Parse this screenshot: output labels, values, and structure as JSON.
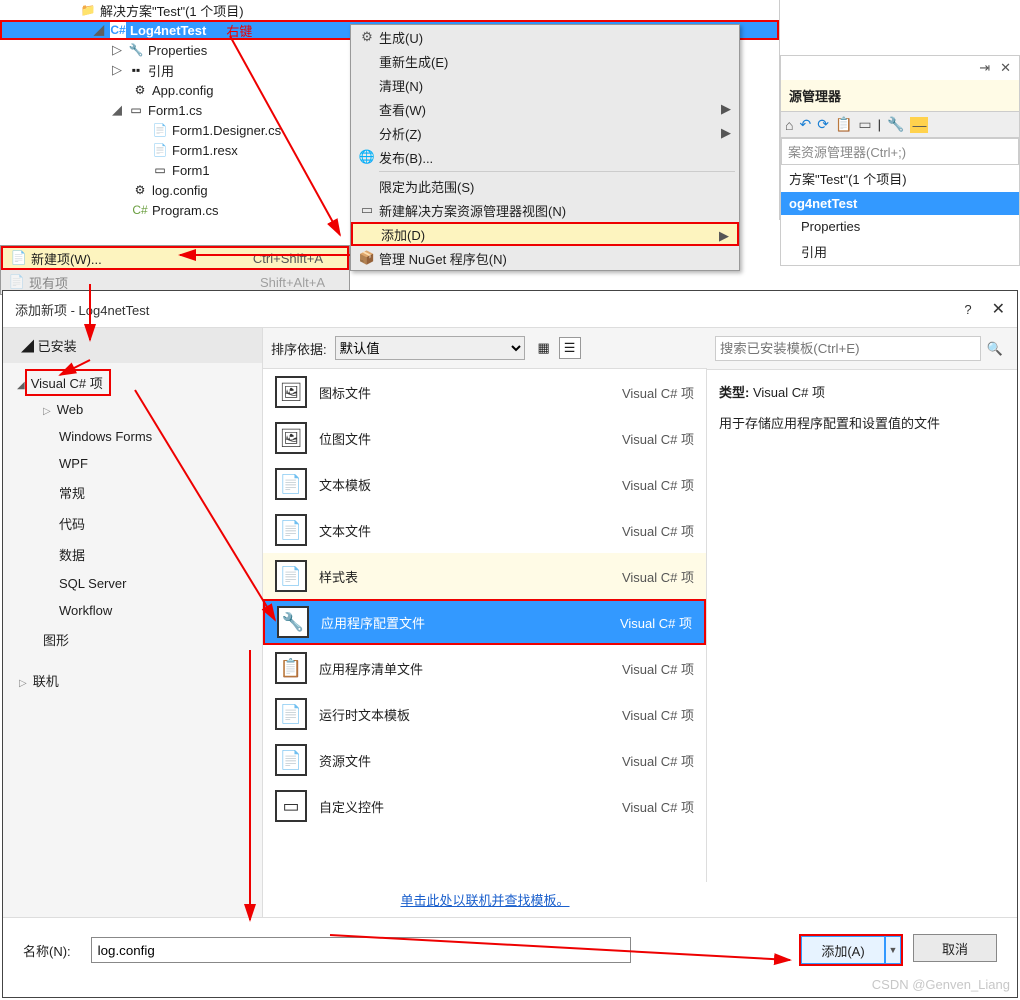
{
  "tree": {
    "solution_label": "解决方案\"Test\"(1 个项目)",
    "project": "Log4netTest",
    "right_click_label": "右键",
    "items": [
      "Properties",
      "引用",
      "App.config",
      "Form1.cs",
      "Form1.Designer.cs",
      "Form1.resx",
      "Form1",
      "log.config",
      "Program.cs"
    ]
  },
  "context_menu": {
    "build": "生成(U)",
    "rebuild": "重新生成(E)",
    "clean": "清理(N)",
    "view": "查看(W)",
    "analyze": "分析(Z)",
    "publish": "发布(B)...",
    "scope": "限定为此范围(S)",
    "newview": "新建解决方案资源管理器视图(N)",
    "add": "添加(D)",
    "manage_nuget": "管理 NuGet 程序包(N)"
  },
  "add_submenu": {
    "new_item": "新建项(W)...",
    "new_item_shortcut": "Ctrl+Shift+A",
    "existing_item": "现有项",
    "existing_item_shortcut": "Shift+Alt+A"
  },
  "se2": {
    "title_suffix": "源管理器",
    "search_placeholder": "案资源管理器(Ctrl+;)",
    "solution": "方案\"Test\"(1 个项目)",
    "project": "og4netTest",
    "items": [
      "Properties",
      "引用"
    ]
  },
  "dialog": {
    "title": "添加新项 - Log4netTest",
    "help": "?",
    "installed": "已安装",
    "left_items": {
      "csharp": "Visual C# 项",
      "web": "Web",
      "winforms": "Windows Forms",
      "wpf": "WPF",
      "general": "常规",
      "code": "代码",
      "data": "数据",
      "sql": "SQL Server",
      "workflow": "Workflow",
      "graphics": "图形",
      "online": "联机"
    },
    "sort_label": "排序依据:",
    "sort_value": "默认值",
    "search_placeholder": "搜索已安装模板(Ctrl+E)",
    "templates": [
      {
        "name": "图标文件",
        "type": "Visual C# 项",
        "icon": "🖼"
      },
      {
        "name": "位图文件",
        "type": "Visual C# 项",
        "icon": "🖼"
      },
      {
        "name": "文本模板",
        "type": "Visual C# 项",
        "icon": "📄"
      },
      {
        "name": "文本文件",
        "type": "Visual C# 项",
        "icon": "📄"
      },
      {
        "name": "样式表",
        "type": "Visual C# 项",
        "icon": "📄",
        "hov": true
      },
      {
        "name": "应用程序配置文件",
        "type": "Visual C# 项",
        "icon": "🔧",
        "sel": true
      },
      {
        "name": "应用程序清单文件",
        "type": "Visual C# 项",
        "icon": "📋"
      },
      {
        "name": "运行时文本模板",
        "type": "Visual C# 项",
        "icon": "📄"
      },
      {
        "name": "资源文件",
        "type": "Visual C# 项",
        "icon": "📄"
      },
      {
        "name": "自定义控件",
        "type": "Visual C# 项",
        "icon": "▭"
      }
    ],
    "link": "单击此处以联机并查找模板。",
    "right": {
      "type_label": "类型:",
      "type_value": "Visual C# 项",
      "desc": "用于存储应用程序配置和设置值的文件"
    },
    "name_label": "名称(N):",
    "name_value": "log.config",
    "add_btn": "添加(A)",
    "cancel_btn": "取消"
  },
  "watermark": "CSDN @Genven_Liang"
}
